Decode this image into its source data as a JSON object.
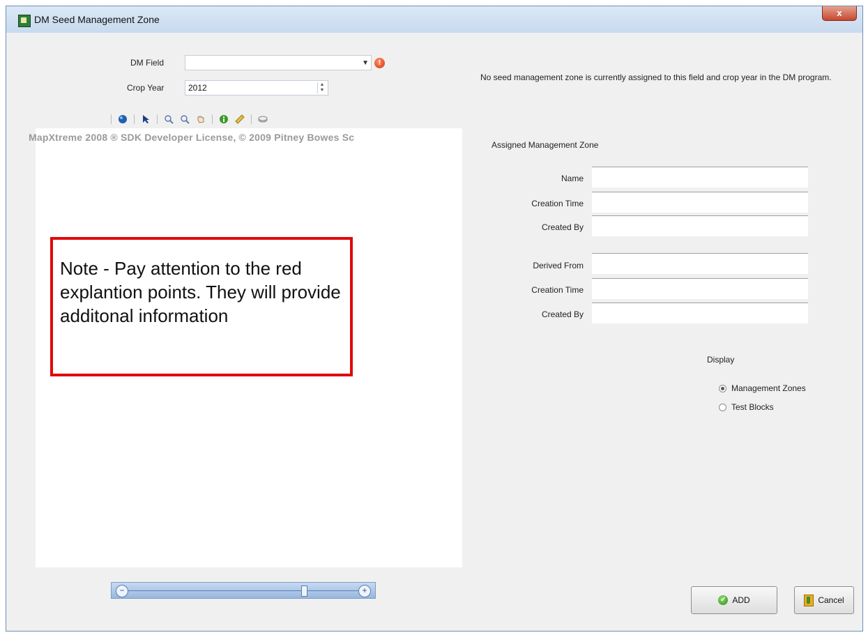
{
  "window": {
    "title": "DM Seed Management Zone",
    "close_label": "x"
  },
  "form": {
    "dm_field_label": "DM Field",
    "dm_field_value": "",
    "crop_year_label": "Crop Year",
    "crop_year_value": "2012"
  },
  "toolbar": {
    "icons": [
      "globe-icon",
      "arrow-pointer-icon",
      "zoom-in-icon",
      "zoom-out-icon",
      "pan-hand-icon",
      "info-icon",
      "ruler-icon",
      "layers-icon"
    ]
  },
  "map": {
    "watermark": "MapXtreme 2008 ® SDK Developer License, © 2009 Pitney Bowes Sc",
    "note": "Note - Pay attention to the red explantion points. They will provide additonal information"
  },
  "status_message": "No seed management zone is currently assigned to this field and crop year in the DM program.",
  "assigned": {
    "heading": "Assigned Management Zone",
    "name_label": "Name",
    "creation_time_label": "Creation Time",
    "created_by_label": "Created By",
    "derived_from_label": "Derived From",
    "derived_creation_time_label": "Creation Time",
    "derived_created_by_label": "Created By"
  },
  "display": {
    "heading": "Display",
    "options": [
      {
        "label": "Management Zones",
        "selected": true
      },
      {
        "label": "Test Blocks",
        "selected": false
      }
    ]
  },
  "buttons": {
    "add_label": "ADD",
    "cancel_label": "Cancel"
  },
  "colors": {
    "note_border": "#e00a0a",
    "alert": "#d43a10",
    "titlebar": "#c8daef"
  }
}
